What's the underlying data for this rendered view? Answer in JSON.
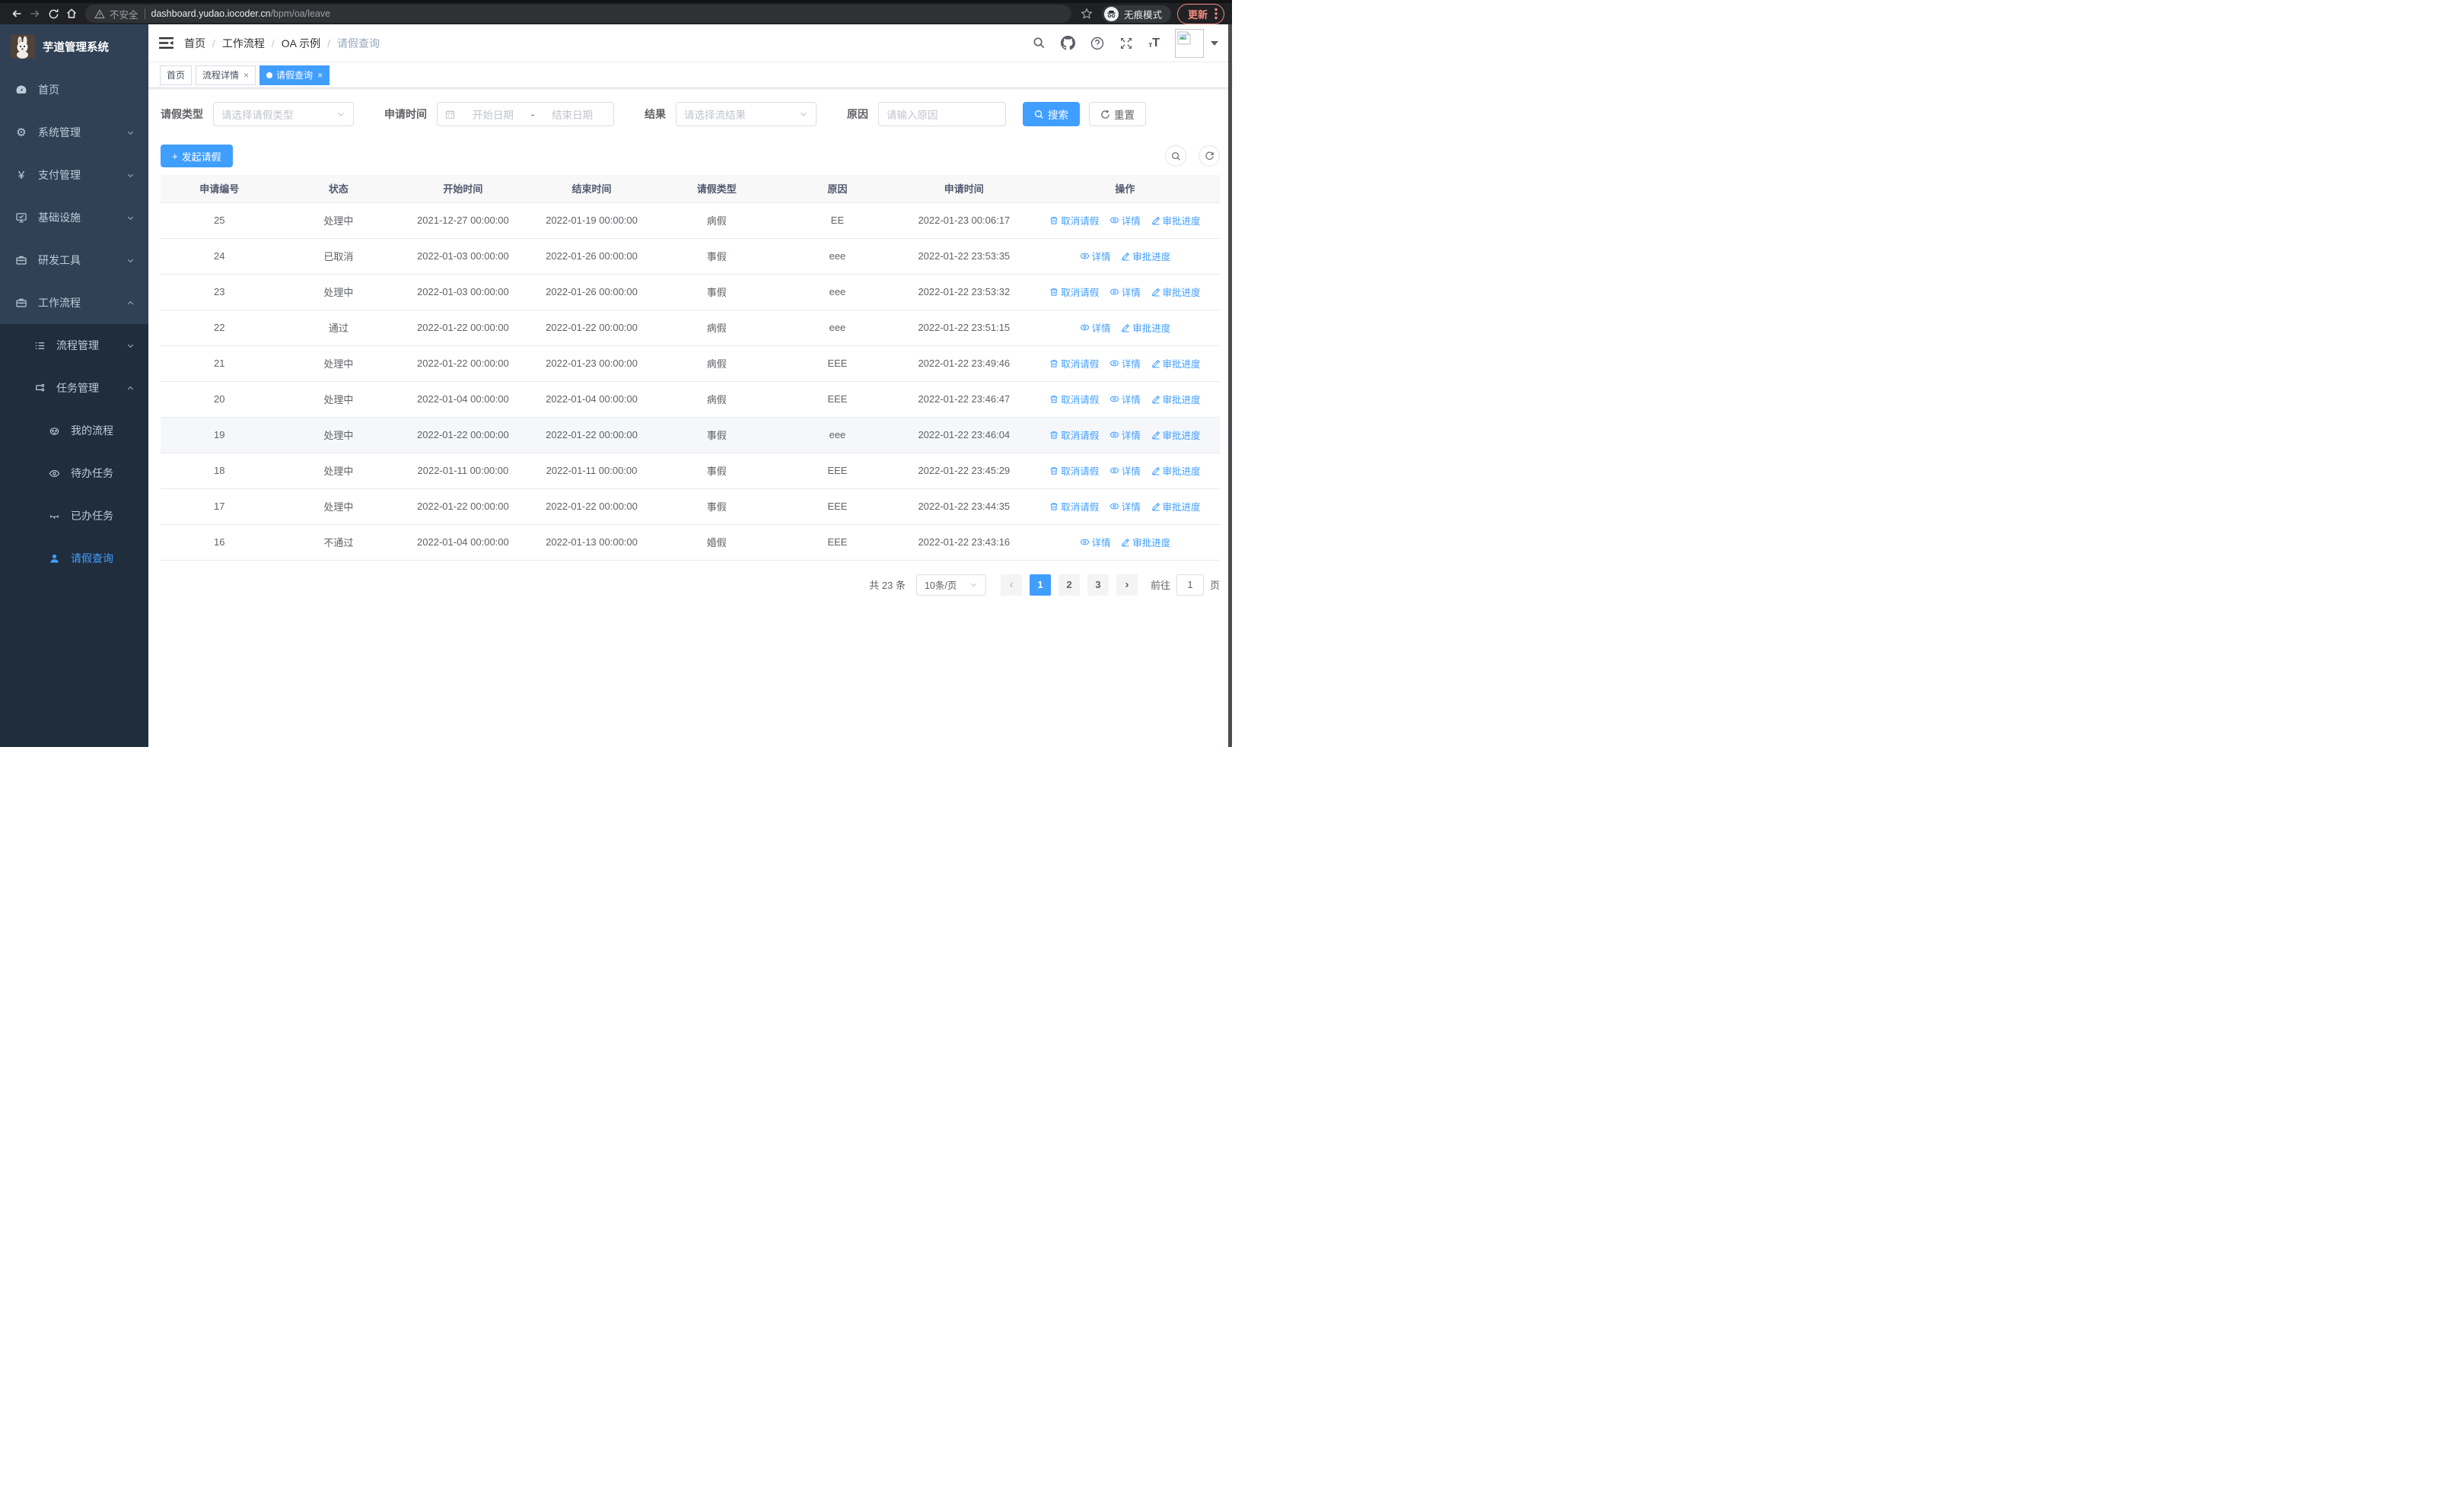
{
  "browser": {
    "security_label": "不安全",
    "url_host": "dashboard.yudao.iocoder.cn",
    "url_path": "/bpm/oa/leave",
    "incognito_label": "无痕模式",
    "update_label": "更新"
  },
  "icons": {
    "close": "×",
    "breadcrumb_separator": "/",
    "plus": "+",
    "prev": "‹",
    "next": "›",
    "yen": "¥",
    "font_small": "т",
    "font_large": "T"
  },
  "sidebar": {
    "title": "芋道管理系统",
    "items": [
      {
        "label": "首页"
      },
      {
        "label": "系统管理"
      },
      {
        "label": "支付管理"
      },
      {
        "label": "基础设施"
      },
      {
        "label": "研发工具"
      },
      {
        "label": "工作流程"
      },
      {
        "label": "流程管理"
      },
      {
        "label": "任务管理"
      },
      {
        "label": "我的流程"
      },
      {
        "label": "待办任务"
      },
      {
        "label": "已办任务"
      },
      {
        "label": "请假查询"
      }
    ]
  },
  "breadcrumb": {
    "items": [
      "首页",
      "工作流程",
      "OA 示例",
      "请假查询"
    ]
  },
  "tabs": [
    {
      "label": "首页"
    },
    {
      "label": "流程详情"
    },
    {
      "label": "请假查询"
    }
  ],
  "filters": {
    "leave_type_label": "请假类型",
    "leave_type_placeholder": "请选择请假类型",
    "apply_time_label": "申请时间",
    "date_start_placeholder": "开始日期",
    "date_separator": "-",
    "date_end_placeholder": "结束日期",
    "result_label": "结果",
    "result_placeholder": "请选择流结果",
    "reason_label": "原因",
    "reason_placeholder": "请输入原因",
    "search_label": "搜索",
    "reset_label": "重置"
  },
  "toolbar": {
    "create_label": "发起请假"
  },
  "table": {
    "columns": [
      "申请编号",
      "状态",
      "开始时间",
      "结束时间",
      "请假类型",
      "原因",
      "申请时间",
      "操作"
    ],
    "rows": [
      {
        "id": "25",
        "status": "处理中",
        "start": "2021-12-27 00:00:00",
        "end": "2022-01-19 00:00:00",
        "type": "病假",
        "reason": "EE",
        "time": "2022-01-23 00:06:17",
        "has_cancel": true,
        "highlighted": false
      },
      {
        "id": "24",
        "status": "已取消",
        "start": "2022-01-03 00:00:00",
        "end": "2022-01-26 00:00:00",
        "type": "事假",
        "reason": "eee",
        "time": "2022-01-22 23:53:35",
        "has_cancel": false,
        "highlighted": false
      },
      {
        "id": "23",
        "status": "处理中",
        "start": "2022-01-03 00:00:00",
        "end": "2022-01-26 00:00:00",
        "type": "事假",
        "reason": "eee",
        "time": "2022-01-22 23:53:32",
        "has_cancel": true,
        "highlighted": false
      },
      {
        "id": "22",
        "status": "通过",
        "start": "2022-01-22 00:00:00",
        "end": "2022-01-22 00:00:00",
        "type": "病假",
        "reason": "eee",
        "time": "2022-01-22 23:51:15",
        "has_cancel": false,
        "highlighted": false
      },
      {
        "id": "21",
        "status": "处理中",
        "start": "2022-01-22 00:00:00",
        "end": "2022-01-23 00:00:00",
        "type": "病假",
        "reason": "EEE",
        "time": "2022-01-22 23:49:46",
        "has_cancel": true,
        "highlighted": false
      },
      {
        "id": "20",
        "status": "处理中",
        "start": "2022-01-04 00:00:00",
        "end": "2022-01-04 00:00:00",
        "type": "病假",
        "reason": "EEE",
        "time": "2022-01-22 23:46:47",
        "has_cancel": true,
        "highlighted": false
      },
      {
        "id": "19",
        "status": "处理中",
        "start": "2022-01-22 00:00:00",
        "end": "2022-01-22 00:00:00",
        "type": "事假",
        "reason": "eee",
        "time": "2022-01-22 23:46:04",
        "has_cancel": true,
        "highlighted": true
      },
      {
        "id": "18",
        "status": "处理中",
        "start": "2022-01-11 00:00:00",
        "end": "2022-01-11 00:00:00",
        "type": "事假",
        "reason": "EEE",
        "time": "2022-01-22 23:45:29",
        "has_cancel": true,
        "highlighted": false
      },
      {
        "id": "17",
        "status": "处理中",
        "start": "2022-01-22 00:00:00",
        "end": "2022-01-22 00:00:00",
        "type": "事假",
        "reason": "EEE",
        "time": "2022-01-22 23:44:35",
        "has_cancel": true,
        "highlighted": false
      },
      {
        "id": "16",
        "status": "不通过",
        "start": "2022-01-04 00:00:00",
        "end": "2022-01-13 00:00:00",
        "type": "婚假",
        "reason": "EEE",
        "time": "2022-01-22 23:43:16",
        "has_cancel": false,
        "highlighted": false
      }
    ]
  },
  "actions": {
    "cancel": "取消请假",
    "detail": "详情",
    "progress": "审批进度"
  },
  "pagination": {
    "total": "共 23 条",
    "page_size": "10条/页",
    "pages": [
      "1",
      "2",
      "3"
    ],
    "goto_label": "前往",
    "goto_value": "1",
    "unit": "页"
  },
  "colors": {
    "accent": "#409eff",
    "sidebar_bg": "#304156",
    "submenu_bg": "#1f2d3d",
    "chrome_bar": "#202124",
    "update_accent": "#f28b82"
  }
}
